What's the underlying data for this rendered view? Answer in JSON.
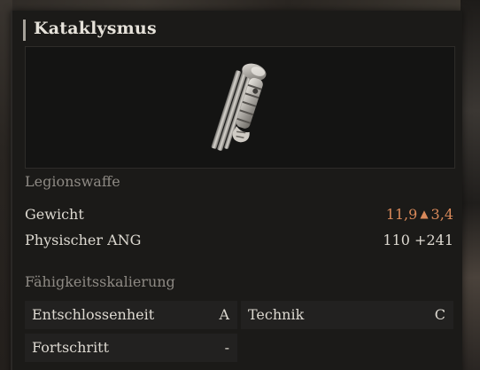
{
  "item": {
    "name": "Kataklysmus",
    "type": "Legionswaffe"
  },
  "stats": {
    "weight_label": "Gewicht",
    "weight_value": "11,9",
    "weight_change": "3,4",
    "weight_change_icon": "up-arrow-icon",
    "attack_label": "Physischer ANG",
    "attack_value": "110 +241"
  },
  "scaling": {
    "title": "Fähigkeitsskalierung",
    "entries": [
      {
        "label": "Entschlossenheit",
        "grade": "A"
      },
      {
        "label": "Technik",
        "grade": "C"
      },
      {
        "label": "Fortschritt",
        "grade": "-"
      }
    ]
  },
  "colors": {
    "weight_highlight": "#d9895a",
    "text_primary": "#ddd9d1",
    "text_muted": "#8e8a84",
    "panel_bg": "#1b1a18"
  }
}
